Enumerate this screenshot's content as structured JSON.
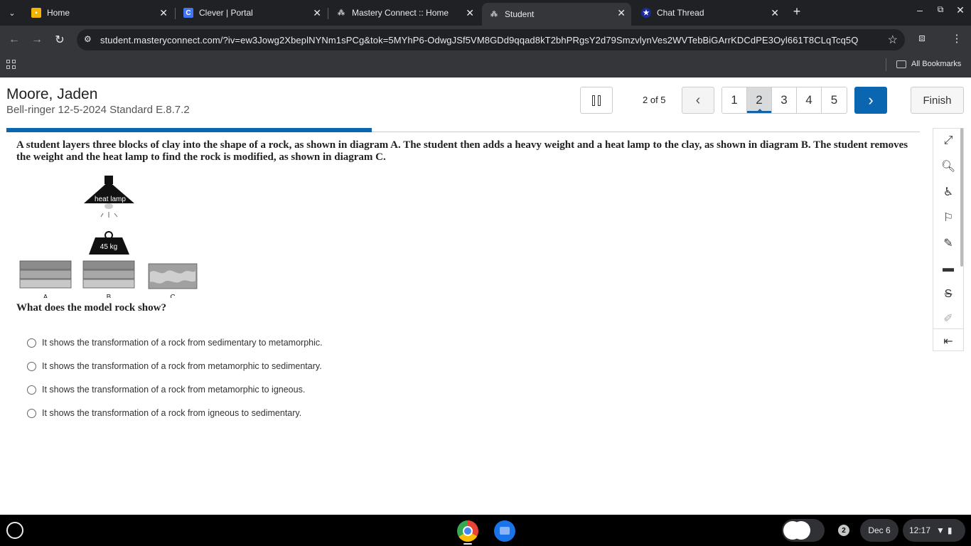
{
  "browser": {
    "tabs": [
      {
        "title": "Home",
        "favicon": "google-classroom-icon",
        "color": "#f4b400"
      },
      {
        "title": "Clever | Portal",
        "favicon": "clever-icon",
        "color": "#4274f6"
      },
      {
        "title": "Mastery Connect :: Home",
        "favicon": "mastery-connect-icon",
        "color": "#9aa0a6"
      },
      {
        "title": "Student",
        "favicon": "mastery-connect-icon",
        "color": "#9aa0a6",
        "active": true
      },
      {
        "title": "Chat Thread",
        "favicon": "star-icon",
        "color": "#1a2a9a"
      }
    ],
    "url": "student.masteryconnect.com/?iv=ew3Jowg2XbeplNYNm1sPCg&tok=5MYhP6-OdwgJSf5VM8GDd9qqad8kT2bhPRgsY2d79SmzvlynVes2WVTebBiGArrKDCdPE3Oyl661T8CLqTcq5Q",
    "bookmarks_label": "All Bookmarks"
  },
  "header": {
    "student_name": "Moore, Jaden",
    "assessment_title": "Bell-ringer 12-5-2024 Standard E.8.7.2",
    "question_counter": "2 of 5",
    "question_numbers": [
      "1",
      "2",
      "3",
      "4",
      "5"
    ],
    "current_question": "2",
    "finish_label": "Finish",
    "progress_fraction": 0.4
  },
  "question": {
    "stem": "A student layers three blocks of clay into the shape of a rock, as shown in diagram A. The student then adds a heavy weight and a heat lamp to the clay, as shown in diagram B. The student removes the weight and the heat lamp to find the rock is modified, as shown in diagram C.",
    "diagram": {
      "heat_lamp_label": "heat lamp",
      "weight_label": "45 kg",
      "label_a": "A",
      "label_b": "B",
      "label_c": "C"
    },
    "prompt": "What does the model rock show?",
    "choices": [
      "It shows the transformation of a rock from sedimentary to metamorphic.",
      "It shows the transformation of a rock from metamorphic to sedimentary.",
      "It shows the transformation of a rock from metamorphic to igneous.",
      "It shows the transformation of a rock from igneous to sedimentary."
    ]
  },
  "tools": [
    "expand-icon",
    "magnifier-icon",
    "accessibility-icon",
    "flag-icon",
    "notepad-icon",
    "line-reader-icon",
    "strikethrough-icon",
    "highlighter-icon",
    "collapse-panel-icon"
  ],
  "shelf": {
    "notification_count": "2",
    "date": "Dec 6",
    "time": "12:17"
  }
}
